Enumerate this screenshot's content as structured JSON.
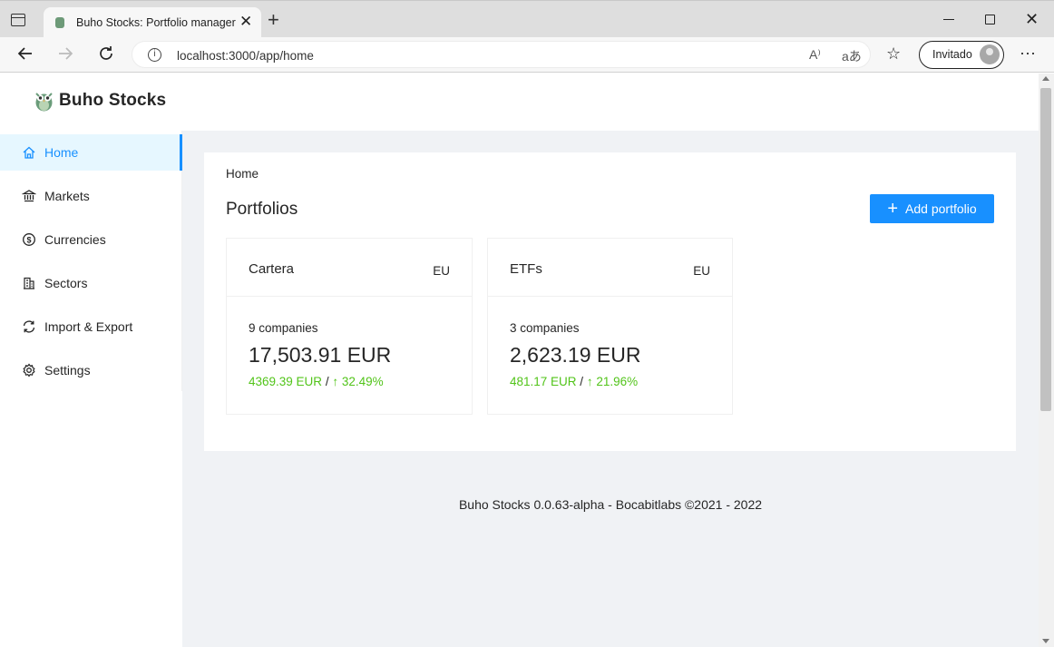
{
  "browser": {
    "tab_title": "Buho Stocks: Portfolio manager",
    "url": "localhost:3000/app/home",
    "profile_label": "Invitado"
  },
  "app": {
    "brand": "Buho Stocks"
  },
  "sidebar": {
    "items": [
      {
        "label": "Home",
        "icon": "home-icon",
        "active": true
      },
      {
        "label": "Markets",
        "icon": "bank-icon",
        "active": false
      },
      {
        "label": "Currencies",
        "icon": "dollar-circle-icon",
        "active": false
      },
      {
        "label": "Sectors",
        "icon": "building-icon",
        "active": false
      },
      {
        "label": "Import & Export",
        "icon": "sync-icon",
        "active": false
      },
      {
        "label": "Settings",
        "icon": "gear-icon",
        "active": false
      }
    ]
  },
  "main": {
    "breadcrumb": "Home",
    "title": "Portfolios",
    "add_button": "Add portfolio",
    "portfolios": [
      {
        "name": "Cartera",
        "region": "EU",
        "companies": "9 companies",
        "value": "17,503.91 EUR",
        "return_amount": "4369.39 EUR",
        "return_percent": "32.49%"
      },
      {
        "name": "ETFs",
        "region": "EU",
        "companies": "3 companies",
        "value": "2,623.19 EUR",
        "return_amount": "481.17 EUR",
        "return_percent": "21.96%"
      }
    ]
  },
  "footer": {
    "text": "Buho Stocks 0.0.63-alpha - Bocabitlabs ©2021 - 2022"
  },
  "colors": {
    "primary": "#1890ff",
    "positive": "#52c41a",
    "active_bg": "#e6f7ff",
    "layout_bg": "#f0f2f5"
  }
}
